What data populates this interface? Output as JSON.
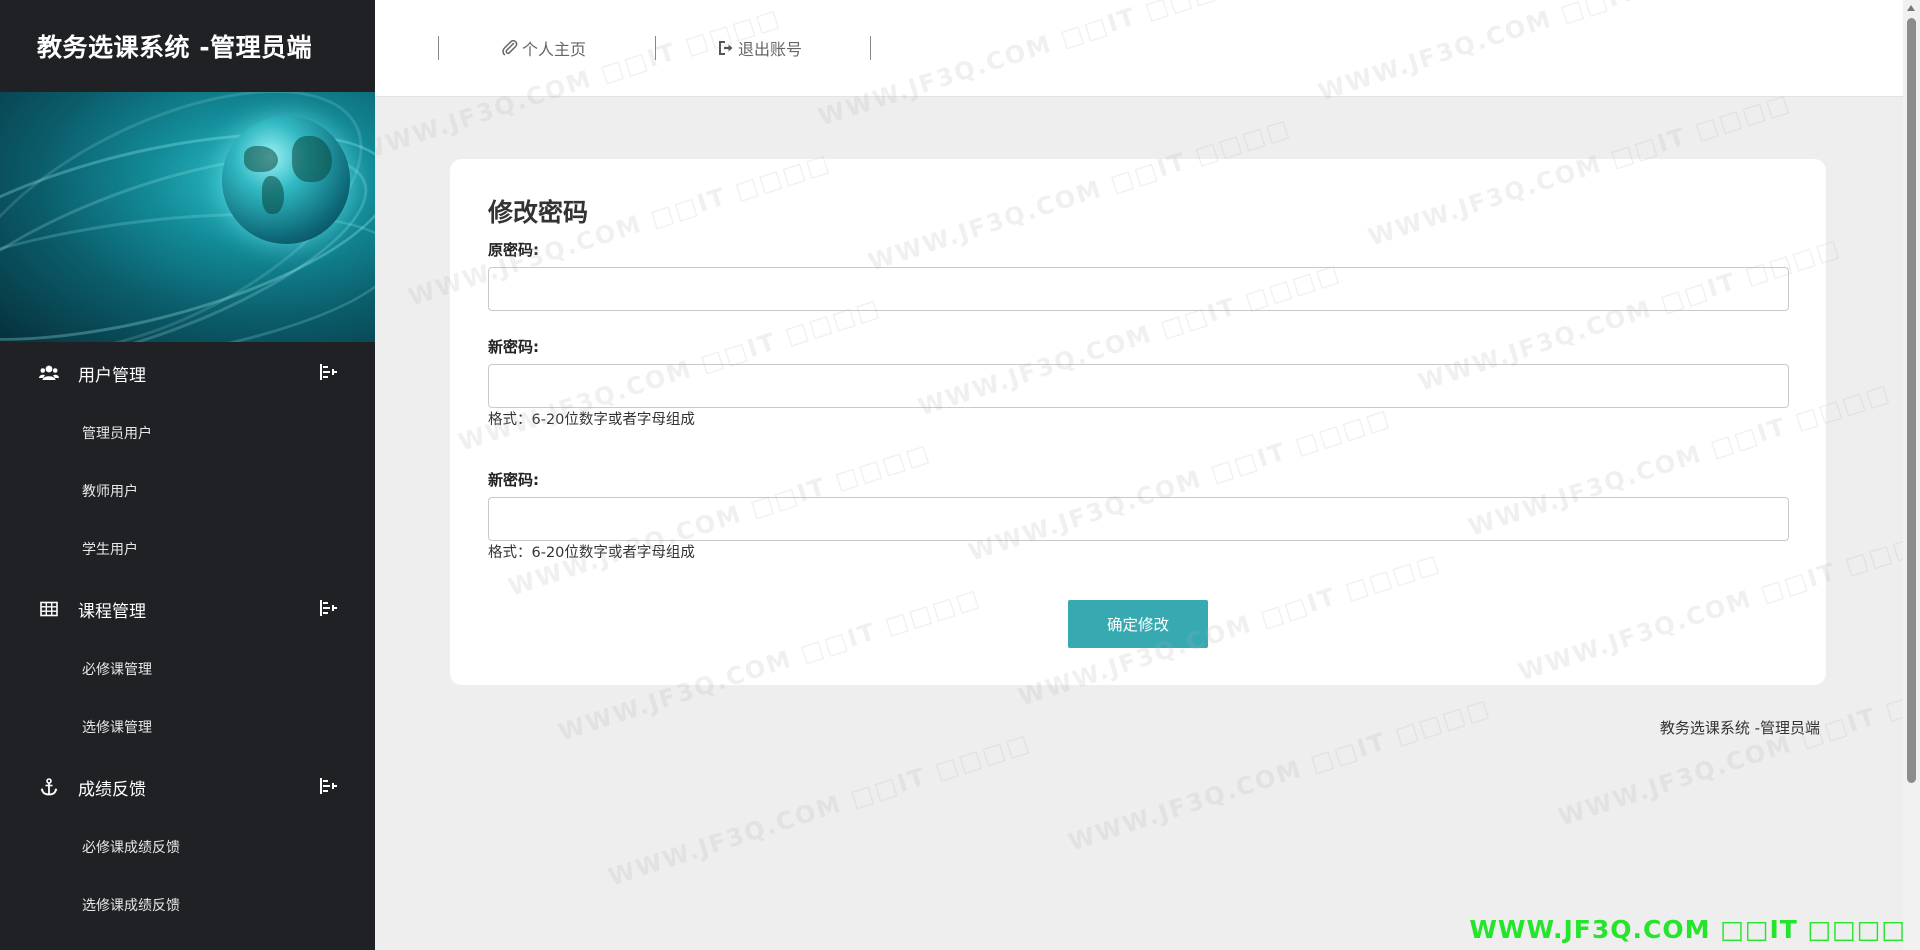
{
  "app": {
    "title": "教务选课系统 -管理员端"
  },
  "sidebar": {
    "groups": [
      {
        "label": "用户管理",
        "icon": "users-icon",
        "items": [
          {
            "label": "管理员用户"
          },
          {
            "label": "教师用户"
          },
          {
            "label": "学生用户"
          }
        ]
      },
      {
        "label": "课程管理",
        "icon": "table-icon",
        "items": [
          {
            "label": "必修课管理"
          },
          {
            "label": "选修课管理"
          }
        ]
      },
      {
        "label": "成绩反馈",
        "icon": "anchor-icon",
        "items": [
          {
            "label": "必修课成绩反馈"
          },
          {
            "label": "选修课成绩反馈"
          }
        ]
      }
    ]
  },
  "header": {
    "home_label": "个人主页",
    "logout_label": "退出账号"
  },
  "form": {
    "title": "修改密码",
    "old_password_label": "原密码:",
    "new_password_label": "新密码:",
    "confirm_password_label": "新密码:",
    "format_hint": "格式：6-20位数字或者字母组成",
    "format_hint_2": "格式：6-20位数字或者字母组成",
    "old_password_value": "",
    "new_password_value": "",
    "confirm_password_value": "",
    "submit_label": "确定修改"
  },
  "footer": {
    "text": "教务选课系统 -管理员端"
  },
  "watermark": {
    "text": "WWW.JF3Q.COM □□IT □□□□",
    "corner_text": "WWW.JF3Q.COM □□IT □□□□"
  },
  "colors": {
    "sidebar_bg": "#1f2124",
    "accent": "#37aab1",
    "page_bg": "#eeeeee",
    "watermark_corner": "#24e52b"
  }
}
